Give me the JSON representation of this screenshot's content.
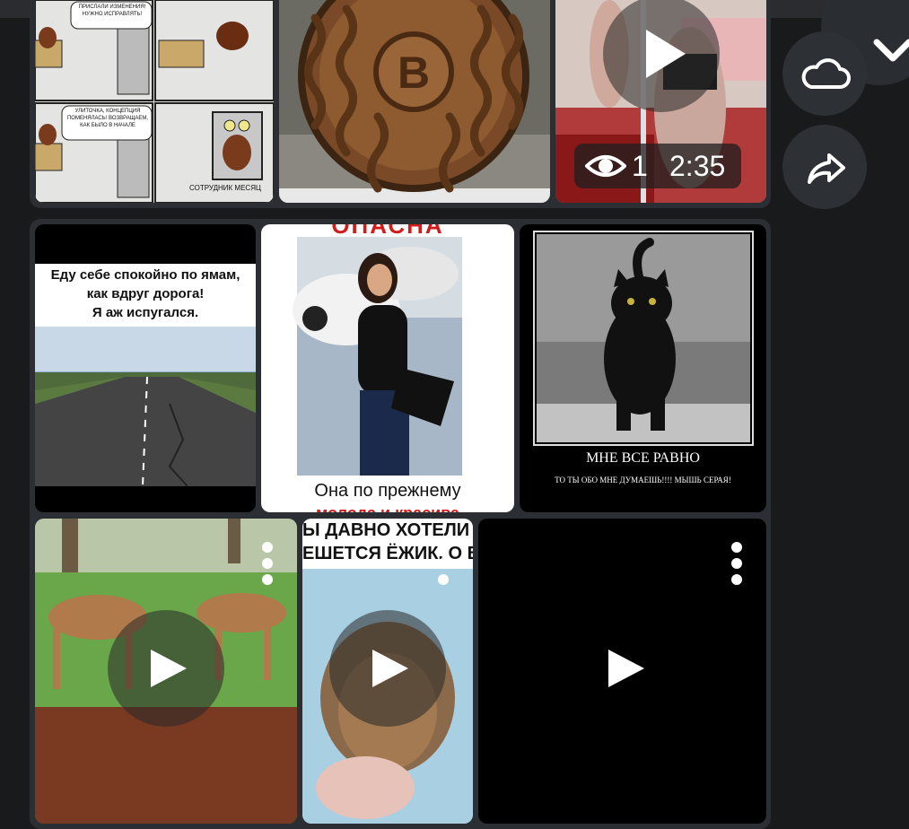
{
  "row1": {
    "comic": {
      "panel_top_right_text": "ПРИСЛАЛИ ИЗМЕНЕНИЯ! НУЖНО ИСПРАВЛЯТЬ!",
      "panel_bottom_left_text": "УЛИТОЧКА, КОНЦЕПЦИЯ ПОМЕНЯЛАСЬ! ВОЗВРАЩАЕМ, КАК БЫЛО В НАЧАЛЕ",
      "caption": "СОТРУДНИК МЕСЯЦ"
    },
    "video": {
      "views": "1",
      "duration": "2:35"
    }
  },
  "row2": {
    "road": {
      "caption_line1": "Еду себе спокойно по ямам,",
      "caption_line2": "как вдруг дорога!",
      "caption_line3": "Я аж испугался."
    },
    "woman": {
      "top_text": "ОПАСНА",
      "bottom_text": "Она по прежнему",
      "bottom_text_cut": "молода и красива"
    },
    "cat": {
      "title": "МНЕ ВСЕ РАВНО",
      "subtitle": "ТО ТЫ ОБО МНЕ ДУМАЕШЬ!!!! МЫШЬ СЕРАЯ!"
    }
  },
  "row3": {
    "hedgehog": {
      "line1": "Ы ДАВНО ХОТЕЛИ",
      "line2": "ЕШЕТСЯ ЁЖИК, О В"
    }
  },
  "colors": {
    "background": "#191a1c",
    "card": "#2b2e32",
    "button": "#2d3035"
  },
  "icons": {
    "cloud": "cloud-icon",
    "share": "share-icon",
    "chevron": "chevron-down-icon",
    "eye": "eye-icon",
    "play": "play-icon",
    "more": "more-vertical-icon"
  }
}
